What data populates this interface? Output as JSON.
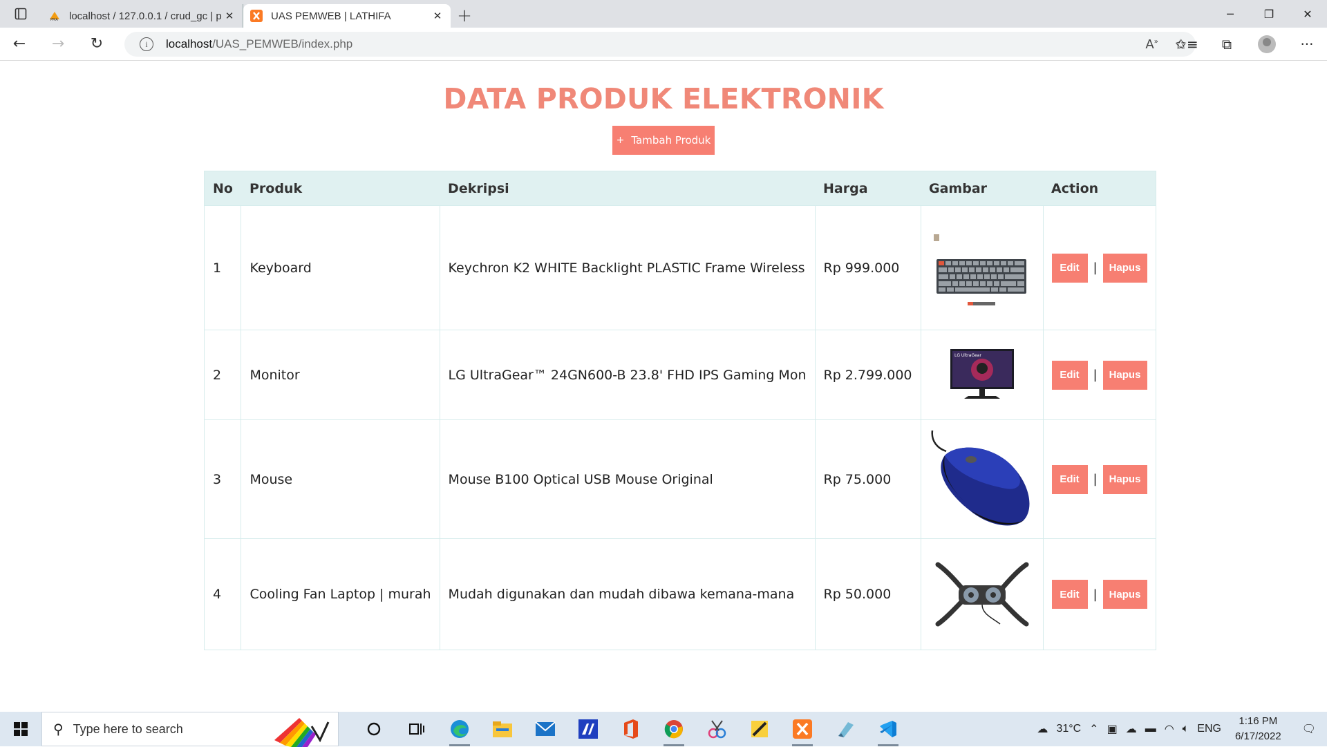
{
  "browser": {
    "tabs": [
      {
        "title": "localhost / 127.0.0.1 / crud_gc | p",
        "active": false,
        "favicon": "phpmyadmin-icon"
      },
      {
        "title": "UAS PEMWEB | LATHIFA",
        "active": true,
        "favicon": "xampp-icon"
      }
    ],
    "url_host": "localhost",
    "url_path": "/UAS_PEMWEB/index.php"
  },
  "page": {
    "title": "DATA PRODUK ELEKTRONIK",
    "add_button": "Tambah Produk",
    "columns": [
      "No",
      "Produk",
      "Dekripsi",
      "Harga",
      "Gambar",
      "Action"
    ],
    "rows": [
      {
        "no": "1",
        "produk": "Keyboard",
        "deskripsi": "Keychron K2 WHITE Backlight PLASTIC Frame Wireless",
        "harga": "Rp 999.000",
        "image": "keyboard-image"
      },
      {
        "no": "2",
        "produk": "Monitor",
        "deskripsi": "LG UltraGear™ 24GN600-B 23.8' FHD IPS Gaming Mon",
        "harga": "Rp 2.799.000",
        "image": "monitor-image"
      },
      {
        "no": "3",
        "produk": "Mouse",
        "deskripsi": "Mouse B100 Optical USB Mouse Original",
        "harga": "Rp 75.000",
        "image": "mouse-image"
      },
      {
        "no": "4",
        "produk": "Cooling Fan Laptop | murah",
        "deskripsi": "Mudah digunakan dan mudah dibawa kemana-mana",
        "harga": "Rp 50.000",
        "image": "cooling-fan-image"
      }
    ],
    "edit_label": "Edit",
    "delete_label": "Hapus",
    "separator": "|"
  },
  "taskbar": {
    "search_placeholder": "Type here to search",
    "temperature": "31°C",
    "language": "ENG",
    "time": "1:16 PM",
    "date": "6/17/2022"
  },
  "colors": {
    "accent": "#f77f72",
    "title": "#f08878",
    "header_bg": "#e0f1f1"
  }
}
